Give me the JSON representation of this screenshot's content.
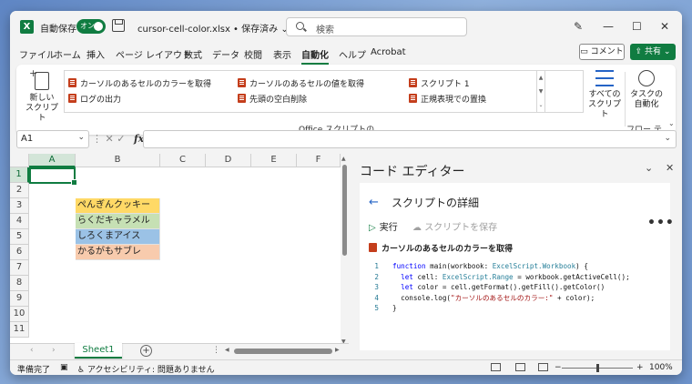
{
  "titlebar": {
    "app_logo": "X",
    "autosave_label": "自動保存",
    "autosave_state": "オン",
    "doc_title": "cursor-cell-color.xlsx • 保存済み ⌄",
    "search_placeholder": "検索",
    "controls": {
      "pen": "pen-icon",
      "minimize": "—",
      "maximize": "☐",
      "close": "✕"
    }
  },
  "menu": {
    "tabs": [
      "ファイル",
      "ホーム",
      "挿入",
      "ページ レイアウト",
      "数式",
      "データ",
      "校閲",
      "表示",
      "自動化",
      "ヘルプ",
      "Acrobat"
    ],
    "active_tab": "自動化",
    "comment_label": "コメント",
    "share_label": "共有"
  },
  "ribbon": {
    "new_script_label": "新しい\nスクリプト",
    "gallery": [
      "カーソルのあるセルのカラーを取得",
      "カーソルのあるセルの値を取得",
      "スクリプト 1",
      "ログの出力",
      "先頭の空白削除",
      "正規表現での置換"
    ],
    "all_scripts_label": "すべての\nスクリプト",
    "task_automation_label": "タスクの\n自動化",
    "group_label_office": "Office スクリプトの",
    "group_label_flow": "フロー テン..."
  },
  "formula_bar": {
    "name_box": "A1",
    "cancel": "✕",
    "enter": "✓",
    "fx": "fx",
    "value": ""
  },
  "sheet": {
    "columns": [
      "A",
      "B",
      "C",
      "D",
      "E",
      "F"
    ],
    "rows": [
      "1",
      "2",
      "3",
      "4",
      "5",
      "6",
      "7",
      "8",
      "9",
      "10",
      "11"
    ],
    "active_cell": "A1",
    "cells": [
      {
        "ref": "B3",
        "text": "ぺんぎんクッキー",
        "fill": "#ffd966"
      },
      {
        "ref": "B4",
        "text": "らくだキャラメル",
        "fill": "#c6e0b4"
      },
      {
        "ref": "B5",
        "text": "しろくまアイス",
        "fill": "#9bc2e6"
      },
      {
        "ref": "B6",
        "text": "かるがもサブレ",
        "fill": "#f8cbad"
      }
    ],
    "tabs": [
      "Sheet1"
    ],
    "active_tab": "Sheet1"
  },
  "code_editor": {
    "title": "コード エディター",
    "details_title": "スクリプトの詳細",
    "run_label": "実行",
    "save_label": "スクリプトを保存",
    "more": "•••",
    "script_name": "カーソルのあるセルのカラーを取得",
    "code_lines": [
      {
        "n": "1",
        "text": "function main(workbook: ExcelScript.Workbook) {"
      },
      {
        "n": "2",
        "text": "  let cell: ExcelScript.Range = workbook.getActiveCell();"
      },
      {
        "n": "3",
        "text": "  let color = cell.getFormat().getFill().getColor()"
      },
      {
        "n": "4",
        "text": "  console.log(\"カーソルのあるセルのカラー:\" + color);"
      },
      {
        "n": "5",
        "text": "}"
      }
    ]
  },
  "statusbar": {
    "ready": "準備完了",
    "accessibility": "アクセシビリティ: 問題ありません",
    "zoom_out": "−",
    "zoom_in": "+",
    "zoom": "100%"
  },
  "colors": {
    "excel_green": "#107c41",
    "script_icon": "#c43e1c",
    "accent_blue": "#2564c6"
  }
}
